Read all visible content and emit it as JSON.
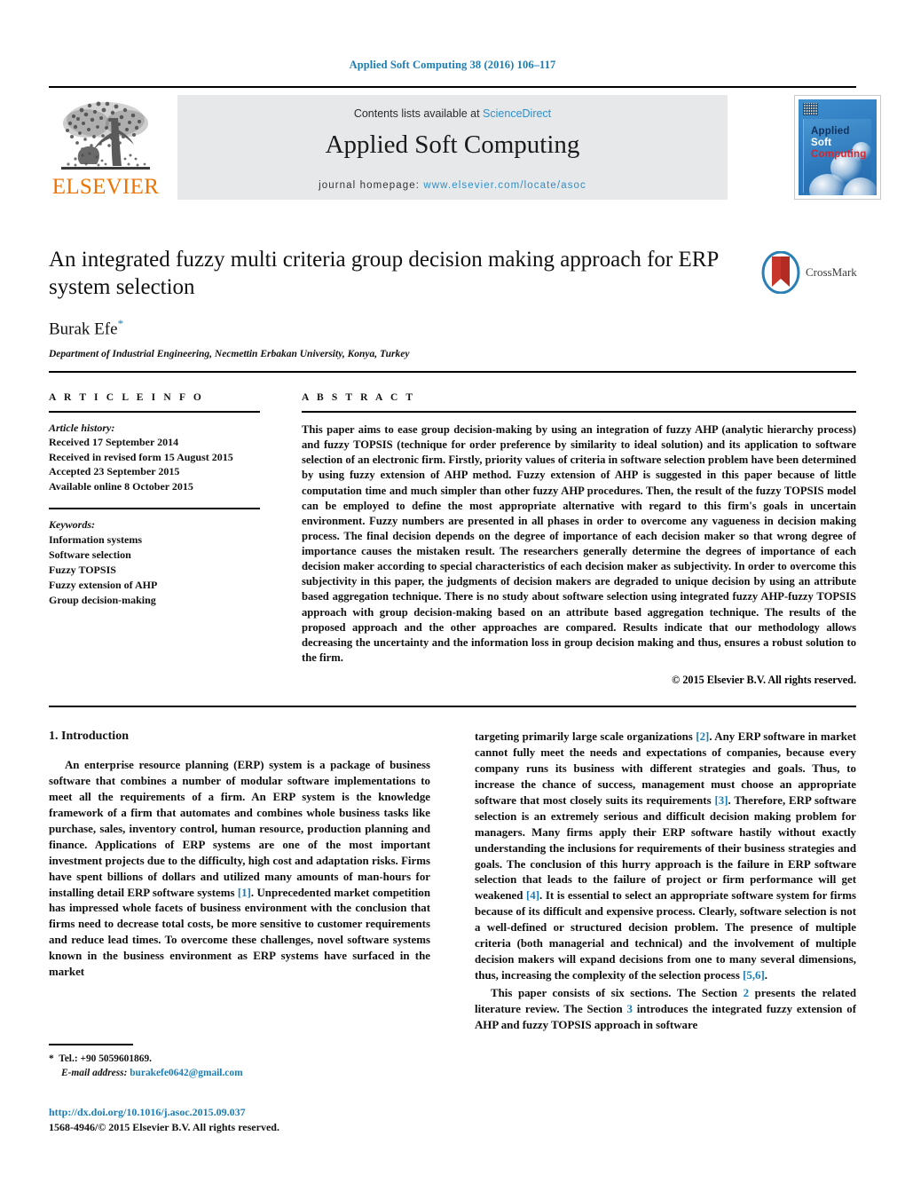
{
  "running_head": "Applied Soft Computing 38 (2016) 106–117",
  "masthead": {
    "publisher_name": "ELSEVIER",
    "contents_prefix": "Contents lists available at ",
    "sciencedirect": "ScienceDirect",
    "journal_title": "Applied Soft Computing",
    "homepage_prefix": "journal homepage: ",
    "homepage_url": "www.elsevier.com/locate/asoc",
    "cover": {
      "line1": "Applied",
      "line2": "Soft",
      "line3": "Computing",
      "line1_color": "#12305c",
      "line2_color": "#ffffff",
      "line3_color": "#d8252b",
      "background_color": "#2f7cc0"
    },
    "link_color": "#2d8fd0",
    "elsevier_orange": "#ec7404",
    "band_color": "#e7e8e9"
  },
  "article": {
    "title": "An integrated fuzzy multi criteria group decision making approach for ERP system selection",
    "author": "Burak Efe",
    "author_footnote_marker": "*",
    "affiliation": "Department of Industrial Engineering, Necmettin Erbakan University, Konya, Turkey",
    "crossmark_label": "CrossMark"
  },
  "info": {
    "heading": "A R T I C L E   I N F O",
    "history_label": "Article history:",
    "history": [
      "Received 17 September 2014",
      "Received in revised form 15 August 2015",
      "Accepted 23 September 2015",
      "Available online 8 October 2015"
    ],
    "keywords_label": "Keywords:",
    "keywords": [
      "Information systems",
      "Software selection",
      "Fuzzy TOPSIS",
      "Fuzzy extension of AHP",
      "Group decision-making"
    ]
  },
  "abstract": {
    "heading": "A B S T R A C T",
    "text": "This paper aims to ease group decision-making by using an integration of fuzzy AHP (analytic hierarchy process) and fuzzy TOPSIS (technique for order preference by similarity to ideal solution) and its application to software selection of an electronic firm. Firstly, priority values of criteria in software selection problem have been determined by using fuzzy extension of AHP method. Fuzzy extension of AHP is suggested in this paper because of little computation time and much simpler than other fuzzy AHP procedures. Then, the result of the fuzzy TOPSIS model can be employed to define the most appropriate alternative with regard to this firm's goals in uncertain environment. Fuzzy numbers are presented in all phases in order to overcome any vagueness in decision making process. The final decision depends on the degree of importance of each decision maker so that wrong degree of importance causes the mistaken result. The researchers generally determine the degrees of importance of each decision maker according to special characteristics of each decision maker as subjectivity. In order to overcome this subjectivity in this paper, the judgments of decision makers are degraded to unique decision by using an attribute based aggregation technique. There is no study about software selection using integrated fuzzy AHP-fuzzy TOPSIS approach with group decision-making based on an attribute based aggregation technique. The results of the proposed approach and the other approaches are compared. Results indicate that our methodology allows decreasing the uncertainty and the information loss in group decision making and thus, ensures a robust solution to the firm.",
    "copyright": "© 2015 Elsevier B.V. All rights reserved."
  },
  "body": {
    "section_number_title": "1.  Introduction",
    "left_paragraph_1": "An enterprise resource planning (ERP) system is a package of business software that combines a number of modular software implementations to meet all the requirements of a firm. An ERP system is the knowledge framework of a firm that automates and combines whole business tasks like purchase, sales, inventory control, human resource, production planning and finance. Applications of ERP systems are one of the most important investment projects due to the difficulty, high cost and adaptation risks. Firms have spent billions of dollars and utilized many amounts of man-hours for installing detail ERP software systems ",
    "left_cite_1": "[1]",
    "left_paragraph_1b": ". Unprecedented market competition has impressed whole facets of business environment with the conclusion that firms need to decrease total costs, be more sensitive to customer requirements and reduce lead times. To overcome these challenges, novel software systems known in the business environment as ERP systems have surfaced in the market",
    "right_paragraph_1a": "targeting primarily large scale organizations ",
    "right_cite_2": "[2]",
    "right_paragraph_1b": ". Any ERP software in market cannot fully meet the needs and expectations of companies, because every company runs its business with different strategies and goals. Thus, to increase the chance of success, management must choose an appropriate software that most closely suits its requirements ",
    "right_cite_3": "[3]",
    "right_paragraph_1c": ". Therefore, ERP software selection is an extremely serious and difficult decision making problem for managers. Many firms apply their ERP software hastily without exactly understanding the inclusions for requirements of their business strategies and goals. The conclusion of this hurry approach is the failure in ERP software selection that leads to the failure of project or firm performance will get weakened ",
    "right_cite_4": "[4]",
    "right_paragraph_1d": ". It is essential to select an appropriate software system for firms because of its difficult and expensive process. Clearly, software selection is not a well-defined or structured decision problem. The presence of multiple criteria (both managerial and technical) and the involvement of multiple decision makers will expand decisions from one to many several dimensions, thus, increasing the complexity of the selection process ",
    "right_cite_56": "[5,6]",
    "right_paragraph_1e": ".",
    "right_paragraph_2a": "This paper consists of six sections. The Section ",
    "right_sec_2": "2",
    "right_paragraph_2b": " presents the related literature review. The Section ",
    "right_sec_3": "3",
    "right_paragraph_2c": " introduces the integrated fuzzy extension of AHP and fuzzy TOPSIS approach in software"
  },
  "footnote": {
    "marker": "*",
    "tel": "Tel.: +90 5059601869.",
    "email_label": "E-mail address:",
    "email": "burakefe0642@gmail.com"
  },
  "doi": {
    "url": "http://dx.doi.org/10.1016/j.asoc.2015.09.037",
    "issn_line": "1568-4946/© 2015 Elsevier B.V. All rights reserved."
  }
}
